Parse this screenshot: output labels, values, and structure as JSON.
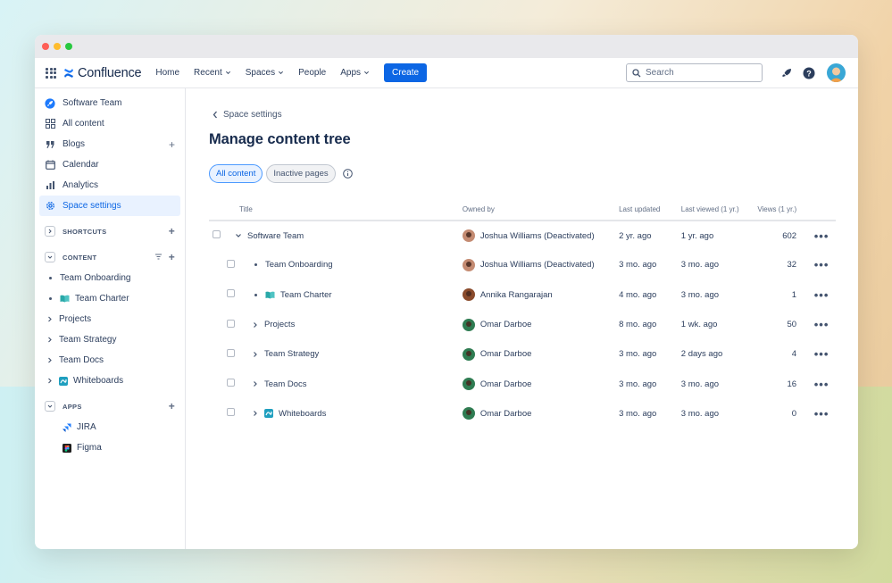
{
  "app": {
    "name": "Confluence"
  },
  "topnav": {
    "items": [
      {
        "label": "Home",
        "has_menu": false
      },
      {
        "label": "Recent",
        "has_menu": true
      },
      {
        "label": "Spaces",
        "has_menu": true
      },
      {
        "label": "People",
        "has_menu": false
      },
      {
        "label": "Apps",
        "has_menu": true
      }
    ],
    "create_label": "Create",
    "search_placeholder": "Search"
  },
  "sidebar": {
    "space_name": "Software Team",
    "items": [
      {
        "label": "All content",
        "icon": "grid-icon"
      },
      {
        "label": "Blogs",
        "icon": "quote-icon"
      },
      {
        "label": "Calendar",
        "icon": "calendar-icon"
      },
      {
        "label": "Analytics",
        "icon": "chart-icon"
      },
      {
        "label": "Space settings",
        "icon": "gear-icon"
      }
    ],
    "shortcuts_label": "SHORTCUTS",
    "content_label": "CONTENT",
    "content_items": [
      {
        "label": "Team Onboarding",
        "marker": "bullet"
      },
      {
        "label": "Team Charter",
        "marker": "bullet",
        "emoji": "book-icon"
      },
      {
        "label": "Projects",
        "marker": "caret"
      },
      {
        "label": "Team Strategy",
        "marker": "caret"
      },
      {
        "label": "Team Docs",
        "marker": "caret"
      },
      {
        "label": "Whiteboards",
        "marker": "caret",
        "emoji": "whiteboard-icon"
      }
    ],
    "apps_label": "APPS",
    "apps": [
      {
        "label": "JIRA",
        "icon": "jira-icon"
      },
      {
        "label": "Figma",
        "icon": "figma-icon"
      }
    ]
  },
  "main": {
    "back_label": "Space settings",
    "title": "Manage content tree",
    "filters": [
      {
        "label": "All content",
        "active": true
      },
      {
        "label": "Inactive pages",
        "active": false
      }
    ],
    "columns": [
      "Title",
      "Owned by",
      "Last updated",
      "Last viewed (1 yr.)",
      "Views (1 yr.)"
    ],
    "rows": [
      {
        "title": "Software Team",
        "owner": "Joshua Williams (Deactivated)",
        "updated": "2 yr. ago",
        "viewed": "1 yr. ago",
        "views": "602"
      },
      {
        "title": "Team Onboarding",
        "owner": "Joshua Williams (Deactivated)",
        "updated": "3 mo. ago",
        "viewed": "3 mo. ago",
        "views": "32"
      },
      {
        "title": "Team Charter",
        "owner": "Annika Rangarajan",
        "updated": "4 mo. ago",
        "viewed": "3 mo. ago",
        "views": "1"
      },
      {
        "title": "Projects",
        "owner": "Omar Darboe",
        "updated": "8 mo. ago",
        "viewed": "1 wk. ago",
        "views": "50"
      },
      {
        "title": "Team Strategy",
        "owner": "Omar Darboe",
        "updated": "3 mo. ago",
        "viewed": "2 days ago",
        "views": "4"
      },
      {
        "title": "Team Docs",
        "owner": "Omar Darboe",
        "updated": "3 mo. ago",
        "viewed": "3 mo. ago",
        "views": "16"
      },
      {
        "title": "Whiteboards",
        "owner": "Omar Darboe",
        "updated": "3 mo. ago",
        "viewed": "3 mo. ago",
        "views": "0"
      }
    ],
    "more_label": "•••"
  },
  "colors": {
    "accent": "#0c66e4",
    "active_bg": "#e9f2ff"
  }
}
